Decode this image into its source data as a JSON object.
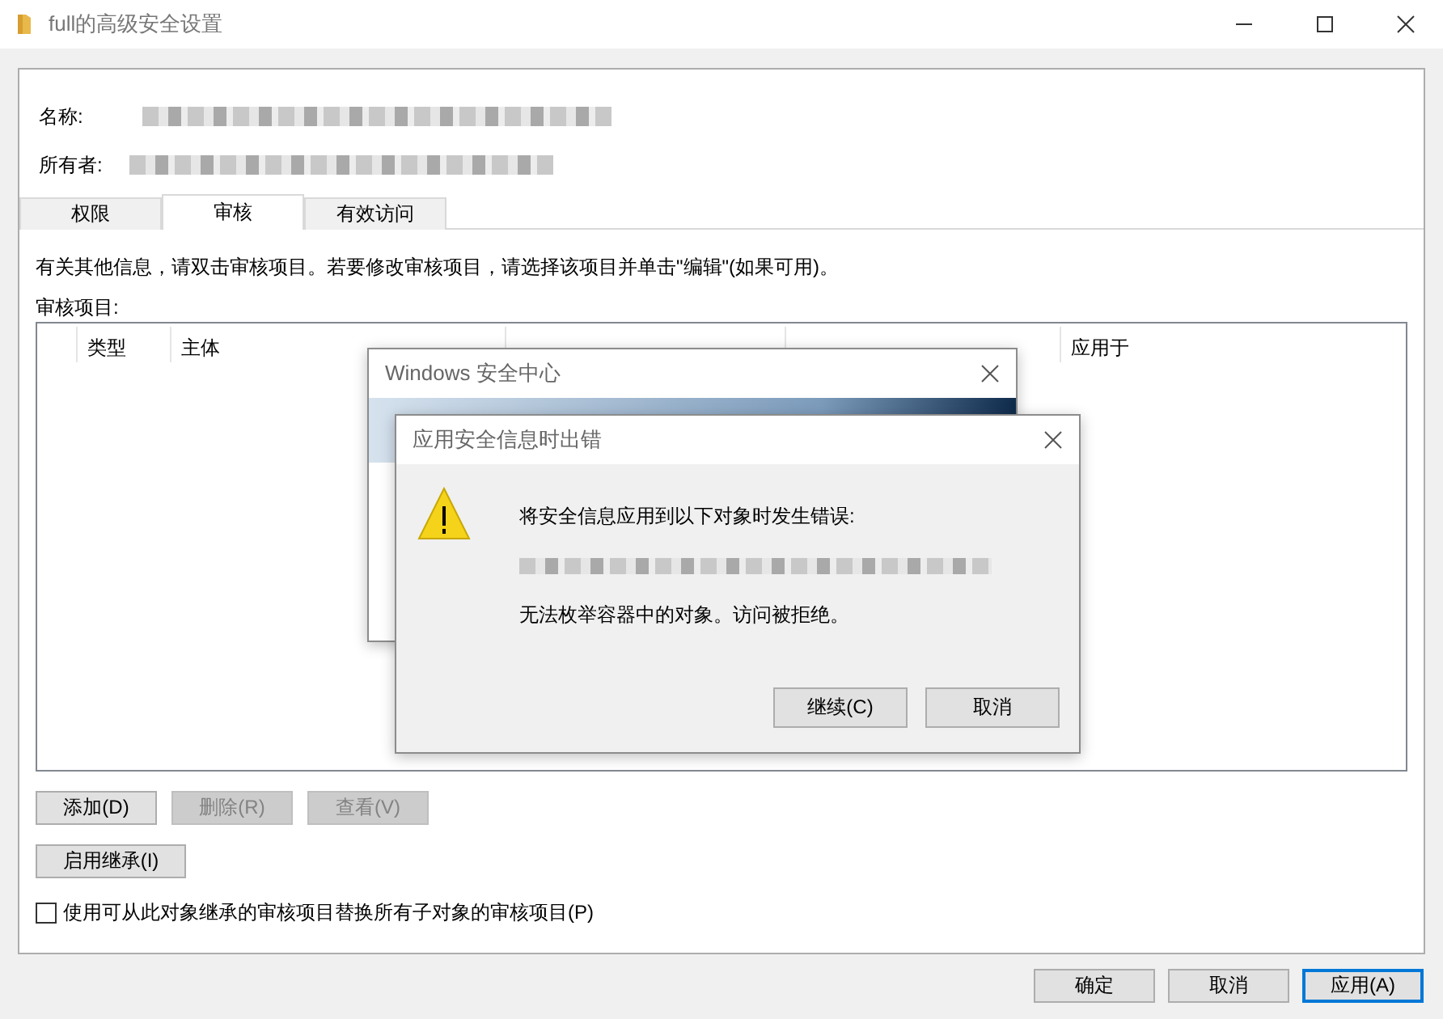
{
  "window": {
    "title": "full的高级安全设置"
  },
  "fields": [
    {
      "label": "名称:"
    },
    {
      "label": "所有者:"
    }
  ],
  "tabs": [
    {
      "label": "权限",
      "selected": false
    },
    {
      "label": "审核",
      "selected": true
    },
    {
      "label": "有效访问",
      "selected": false
    }
  ],
  "info_text": "有关其他信息，请双击审核项目。若要修改审核项目，请选择该项目并单击\"编辑\"(如果可用)。",
  "table": {
    "label": "审核项目:",
    "columns": [
      "类型",
      "主体",
      "",
      "",
      "应用于"
    ]
  },
  "entry_buttons": [
    {
      "label": "添加(D)",
      "disabled": false
    },
    {
      "label": "删除(R)",
      "disabled": true
    },
    {
      "label": "查看(V)",
      "disabled": true
    }
  ],
  "inherit_button": "启用继承(I)",
  "replace_checkbox": {
    "label": "使用可从此对象继承的审核项目替换所有子对象的审核项目(P)",
    "checked": false
  },
  "footer_buttons": [
    {
      "label": "确定",
      "default": false
    },
    {
      "label": "取消",
      "default": false
    },
    {
      "label": "应用(A)",
      "default": true
    }
  ],
  "back_dialog": {
    "title": "Windows 安全中心"
  },
  "error_dialog": {
    "title": "应用安全信息时出错",
    "message": "将安全信息应用到以下对象时发生错误:",
    "detail": "无法枚举容器中的对象。访问被拒绝。",
    "buttons": [
      {
        "label": "继续(C)",
        "default": false
      },
      {
        "label": "取消",
        "default": false
      }
    ]
  }
}
